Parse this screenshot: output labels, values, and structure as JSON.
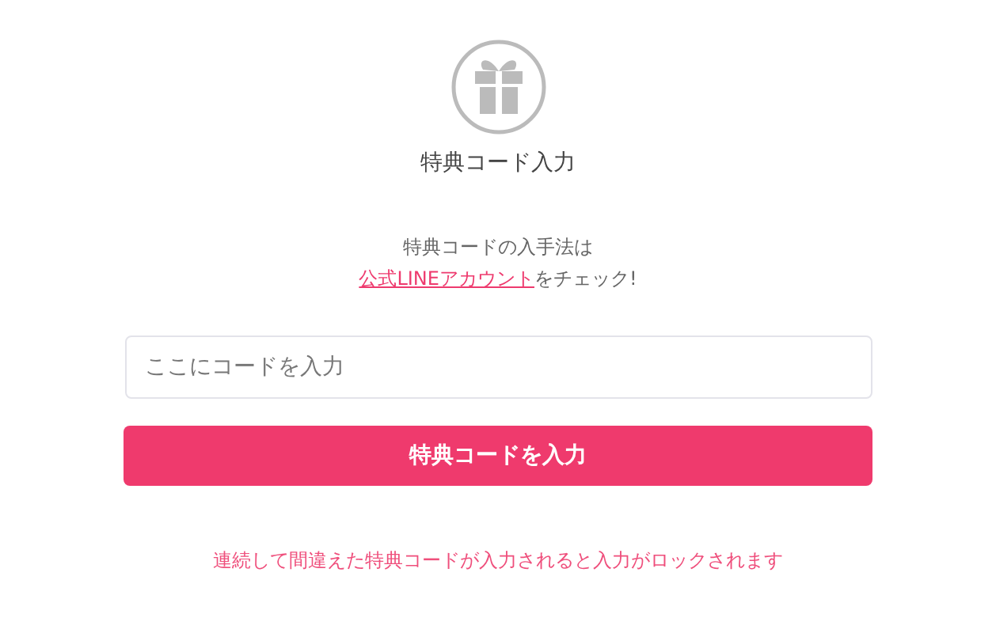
{
  "title": "特典コード入力",
  "instructions": {
    "line": "特典コードの入手法は",
    "link": "公式LINEアカウント",
    "link_suffix": "をチェック!"
  },
  "code_field": {
    "placeholder": "ここにコードを入力"
  },
  "submit_button": "特典コードを入力",
  "warning": "連続して間違えた特典コードが入力されると入力がロックされます"
}
